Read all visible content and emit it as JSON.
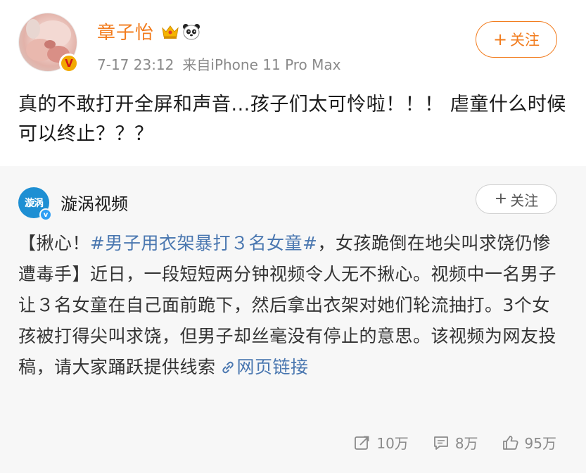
{
  "post": {
    "username": "章子怡",
    "meta_time": "7-17 23:12",
    "meta_source": "来自iPhone 11 Pro Max",
    "follow_label": "关注",
    "text": "真的不敢打开全屏和声音...孩子们太可怜啦！！！ 虐童什么时候可以终止？？？",
    "icons": [
      "crown-icon",
      "panda-icon",
      "verified-badge"
    ]
  },
  "repost": {
    "name": "漩涡视频",
    "logo_text": "漩涡",
    "follow_label": "关注",
    "text_open": "【揪心！",
    "topic": "#男子用衣架暴打３名女童#",
    "text_body": "，女孩跪倒在地尖叫求饶仍惨遭毒手】近日，一段短短两分钟视频令人无不揪心。视频中一名男子让３名女童在自己面前跪下，然后拿出衣架对她们轮流抽打。3个女孩被打得尖叫求饶，但男子却丝毫没有停止的意思。该视频为网友投稿，请大家踊跃提供线索",
    "link_label": "网页链接"
  },
  "actions": {
    "repost_count": "10万",
    "comment_count": "8万",
    "like_count": "95万"
  },
  "colors": {
    "accent_orange": "#f27c1e",
    "link_blue": "#4a77b0",
    "meta_gray": "#8a8a8a",
    "repost_bg": "#f7f7f7"
  }
}
